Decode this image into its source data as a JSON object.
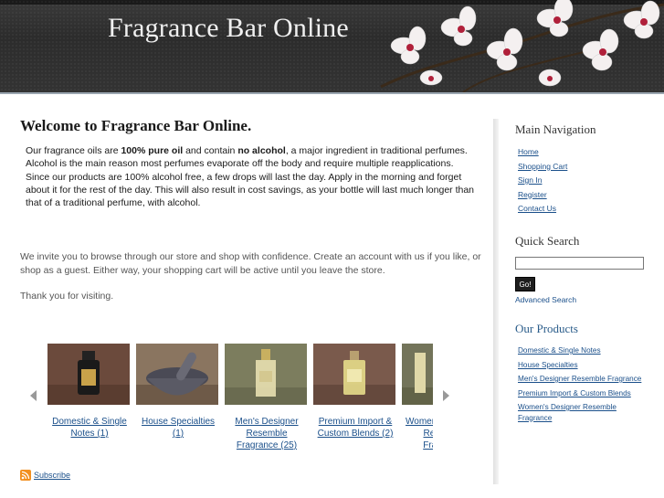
{
  "header": {
    "site_title": "Fragrance Bar Online"
  },
  "main": {
    "welcome_title": "Welcome to Fragrance Bar Online.",
    "intro": {
      "part1": "Our fragrance oils are ",
      "bold1": "100% pure oil",
      "part2": " and contain ",
      "bold2": "no alcohol",
      "part3": ", a major ingredient in traditional perfumes. Alcohol is the main reason most perfumes evaporate off the body and require multiple reapplications. Since our products are 100% alcohol free, a few drops will last the day. Apply in the morning and forget about it for the rest of the day. This will also result in cost savings, as your bottle will last much longer than that of a traditional perfume, with alcohol."
    },
    "invite": "We invite you to browse through our store and shop with confidence. Create an account with us if you like, or shop as a guest. Either way, your shopping cart will be active until you leave the store.",
    "thanks": "Thank you for visiting."
  },
  "carousel": {
    "items": [
      {
        "label": "Domestic & Single Notes  (1)"
      },
      {
        "label": "House Specialties (1)"
      },
      {
        "label": "Men's Designer Resemble Fragrance (25)"
      },
      {
        "label": "Premium Import & Custom Blends  (2)"
      },
      {
        "label": "Women's Designer Resemble Fragrance"
      }
    ]
  },
  "footer": {
    "subscribe": "Subscribe"
  },
  "sidebar": {
    "main_nav_heading": "Main Navigation",
    "nav_items": [
      "Home",
      "Shopping Cart",
      "Sign In",
      "Register",
      "Contact Us"
    ],
    "quick_search_heading": "Quick Search",
    "search_value": "",
    "go_label": "Go!",
    "advanced_search": "Advanced Search",
    "products_heading": "Our Products",
    "products": [
      "Domestic & Single Notes",
      "House Specialties",
      "Men's Designer Resemble Fragrance",
      "Premium Import & Custom Blends",
      "Women's Designer Resemble Fragrance"
    ]
  },
  "colors": {
    "link": "#1a4f8a",
    "header_bg": "#2c2c2c",
    "products_heading": "#2a5c8a",
    "rss": "#f29021"
  }
}
